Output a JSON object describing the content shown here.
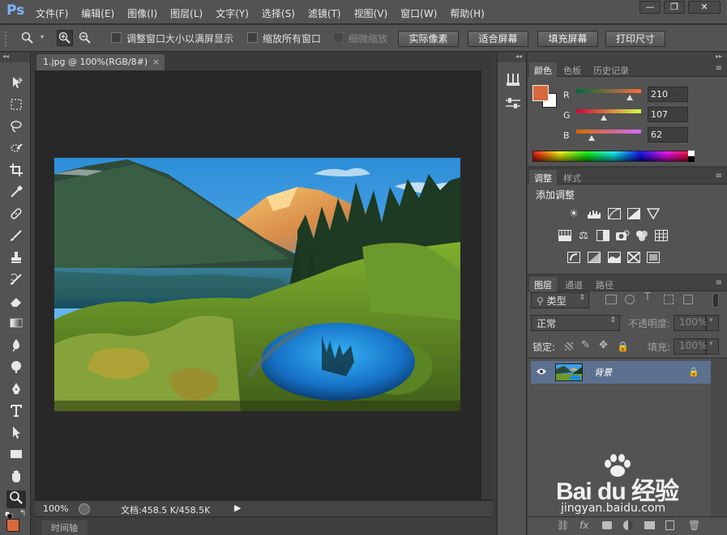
{
  "app": {
    "logo": "Ps",
    "menu": [
      "文件(F)",
      "编辑(E)",
      "图像(I)",
      "图层(L)",
      "文字(Y)",
      "选择(S)",
      "滤镜(T)",
      "视图(V)",
      "窗口(W)",
      "帮助(H)"
    ],
    "window_controls": [
      "—",
      "❐",
      "✕"
    ]
  },
  "options": {
    "resize_windows": "调整窗口大小以满屏显示",
    "zoom_all": "缩放所有窗口",
    "scrubby_zoom": "细微缩放",
    "actual_pixels": "实际像素",
    "fit_screen": "适合屏幕",
    "fill_screen": "填充屏幕",
    "print_size": "打印尺寸"
  },
  "document": {
    "tab_title": "1.jpg @ 100%(RGB/8#)",
    "tab_close": "×",
    "zoom": "100%",
    "doc_info": "文档:458.5 K/458.5K",
    "timeline_tab": "时间轴"
  },
  "color_panel": {
    "tabs": [
      "颜色",
      "色板",
      "历史记录"
    ],
    "foreground": "#d9683d",
    "background": "#ffffff",
    "channels": [
      {
        "label": "R",
        "value": "210",
        "fraction": 0.82
      },
      {
        "label": "G",
        "value": "107",
        "fraction": 0.42
      },
      {
        "label": "B",
        "value": "62",
        "fraction": 0.24
      }
    ]
  },
  "adjust_panel": {
    "tabs": [
      "调整",
      "样式"
    ],
    "title": "添加调整"
  },
  "layers_panel": {
    "tabs": [
      "图层",
      "通道",
      "路径"
    ],
    "filter_kind": "类型",
    "blend_mode": "正常",
    "opacity_label": "不透明度:",
    "opacity_value": "100%",
    "lock_label": "锁定:",
    "fill_label": "填充:",
    "fill_value": "100%",
    "layers": [
      {
        "name": "背景",
        "visible": true,
        "locked": true
      }
    ]
  },
  "watermark": {
    "text": "Bai du 经验",
    "url": "jingyan.baidu.com"
  }
}
